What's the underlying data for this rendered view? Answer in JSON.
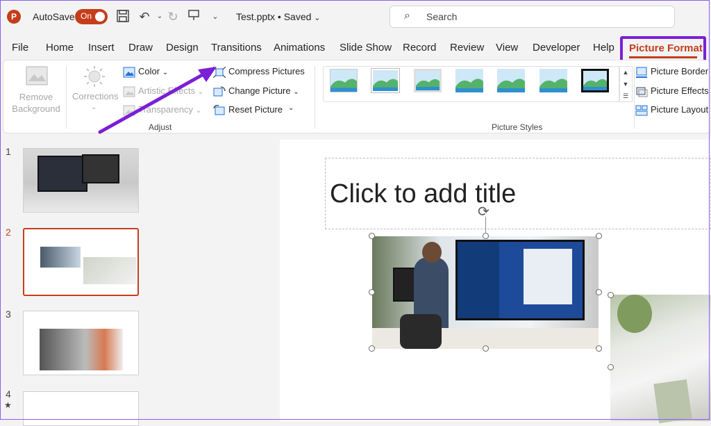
{
  "titlebar": {
    "autosave_label": "AutoSave",
    "autosave_state": "On",
    "file_name": "Test.pptx • Saved",
    "search_placeholder": "Search"
  },
  "tabs": [
    "File",
    "Home",
    "Insert",
    "Draw",
    "Design",
    "Transitions",
    "Animations",
    "Slide Show",
    "Record",
    "Review",
    "View",
    "Developer",
    "Help"
  ],
  "active_tab": "Picture Format",
  "ribbon": {
    "remove_background": "Remove Background",
    "corrections": "Corrections",
    "color": "Color",
    "artistic_effects": "Artistic Effects",
    "transparency": "Transparency",
    "compress_pictures": "Compress Pictures",
    "change_picture": "Change Picture",
    "reset_picture": "Reset Picture",
    "adjust_label": "Adjust",
    "picture_styles_label": "Picture Styles",
    "picture_border": "Picture Border",
    "picture_effects": "Picture Effects",
    "picture_layout": "Picture Layout"
  },
  "slides": [
    {
      "number": "1"
    },
    {
      "number": "2"
    },
    {
      "number": "3"
    },
    {
      "number": "4"
    }
  ],
  "slide": {
    "title_placeholder": "Click to add title"
  },
  "colors": {
    "accent": "#c43e1c",
    "annotation": "#7b1fd6"
  }
}
